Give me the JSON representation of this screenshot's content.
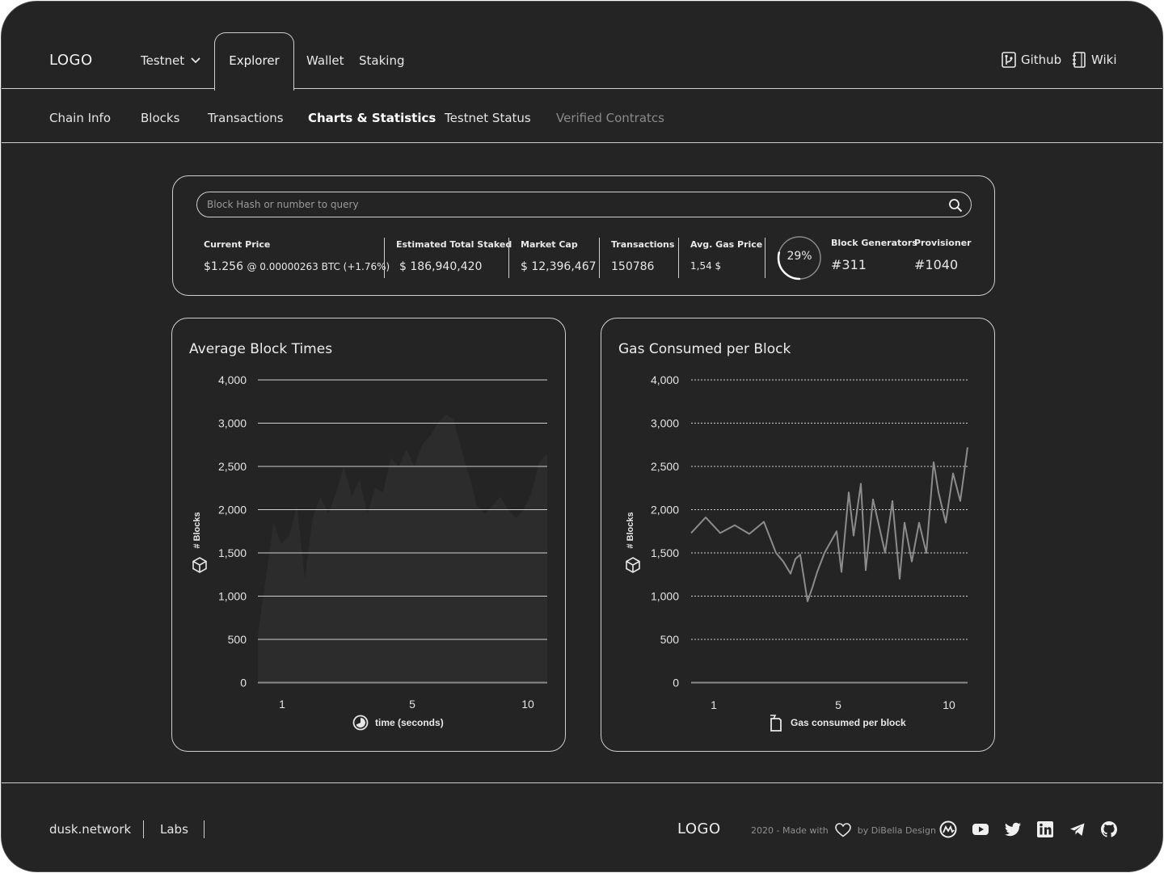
{
  "header": {
    "logo": "LOGO",
    "network_selector": "Testnet",
    "tabs": [
      {
        "label": "Explorer"
      },
      {
        "label": "Wallet"
      },
      {
        "label": "Staking"
      }
    ],
    "links": [
      {
        "label": "Github",
        "icon": "github-branch-icon"
      },
      {
        "label": "Wiki",
        "icon": "notebook-icon"
      }
    ]
  },
  "subnav": {
    "items": [
      {
        "label": "Chain Info"
      },
      {
        "label": "Blocks"
      },
      {
        "label": "Transactions"
      },
      {
        "label": "Charts & Statistics",
        "active": true
      },
      {
        "label": "Testnet Status"
      },
      {
        "label": "Verified Contratcs",
        "disabled": true
      }
    ]
  },
  "search": {
    "placeholder": "Block Hash or number to query"
  },
  "stats": {
    "current_price": {
      "label": "Current Price",
      "value": "$1.256",
      "btc": "@ 0.00000263 BTC (+1.76%)"
    },
    "total_staked": {
      "label": "Estimated Total Staked",
      "value": "$ 186,940,420"
    },
    "market_cap": {
      "label": "Market Cap",
      "value": "$ 12,396,467"
    },
    "transactions": {
      "label": "Transactions",
      "value": "150786"
    },
    "gas_price": {
      "label": "Avg. Gas Price",
      "value": "1,54 $"
    },
    "ring_percent": "29%",
    "ring_fraction": 0.29,
    "block_generators": {
      "label": "Block Generators",
      "value": "#311"
    },
    "provisioner": {
      "label": "Provisioner",
      "value": "#1040"
    }
  },
  "chart_data": [
    {
      "type": "area",
      "title": "Average Block Times",
      "ylabel": "# Blocks",
      "xlabel": "time (seconds)",
      "y_ticks": [
        "4,000",
        "3,000",
        "2,500",
        "2,000",
        "1,500",
        "1,000",
        "500",
        "0"
      ],
      "x_ticks": [
        "1",
        "5",
        "10"
      ],
      "x": [
        0,
        0.3,
        0.6,
        0.9,
        1.2,
        1.5,
        1.8,
        2.1,
        2.4,
        2.7,
        3.0,
        3.3,
        3.6,
        3.9,
        4.2,
        4.5,
        4.8,
        5.1,
        5.4,
        5.7,
        6.0,
        6.3,
        6.6,
        6.9,
        7.2,
        7.5,
        7.8,
        8.1,
        8.4,
        8.7,
        9.0,
        9.3,
        9.6,
        9.9,
        10.2,
        10.5,
        10.8,
        11.1
      ],
      "values": [
        550,
        1200,
        1850,
        1600,
        1700,
        2050,
        1200,
        1900,
        2150,
        1950,
        2200,
        2500,
        2150,
        2350,
        1950,
        2250,
        2200,
        2600,
        2500,
        2700,
        2500,
        2750,
        2850,
        3000,
        3200,
        3100,
        2700,
        2400,
        2050,
        1950,
        2050,
        2150,
        2000,
        1900,
        2000,
        2200,
        2550,
        2650
      ],
      "series_color": "#2c2c2c"
    },
    {
      "type": "line",
      "title": "Gas Consumed per Block",
      "ylabel": "# Blocks",
      "xlabel": "Gas consumed per block",
      "y_ticks": [
        "4,000",
        "3,000",
        "2,500",
        "2,000",
        "1,500",
        "1,000",
        "500",
        "0"
      ],
      "x_ticks": [
        "1",
        "5",
        "10"
      ],
      "x": [
        0,
        0.6,
        1.2,
        1.8,
        2.4,
        3.0,
        3.5,
        3.8,
        4.1,
        4.3,
        4.5,
        4.8,
        5.0,
        5.2,
        5.5,
        6.0,
        6.2,
        6.5,
        6.7,
        7.0,
        7.2,
        7.5,
        8.0,
        8.3,
        8.6,
        8.8,
        9.1,
        9.4,
        9.7,
        10.0,
        10.2,
        10.5,
        10.8,
        11.1,
        11.4
      ],
      "values": [
        1730,
        1910,
        1730,
        1820,
        1720,
        1860,
        1500,
        1400,
        1260,
        1430,
        1480,
        940,
        1100,
        1280,
        1500,
        1750,
        1280,
        2200,
        1700,
        2300,
        1300,
        2120,
        1500,
        2100,
        1200,
        1850,
        1400,
        1850,
        1500,
        2550,
        2200,
        1850,
        2420,
        2100,
        2720
      ],
      "grid": "dotted",
      "series_color": "#8c8c8c"
    }
  ],
  "footer": {
    "links": [
      {
        "label": "dusk.network"
      },
      {
        "label": "Labs"
      }
    ],
    "logo": "LOGO",
    "credit_prefix": "2020  - Made with",
    "credit_suffix": "by DiBella Design",
    "socials": [
      "coinmarketcap-icon",
      "youtube-icon",
      "twitter-icon",
      "linkedin-icon",
      "telegram-icon",
      "github-icon"
    ]
  }
}
